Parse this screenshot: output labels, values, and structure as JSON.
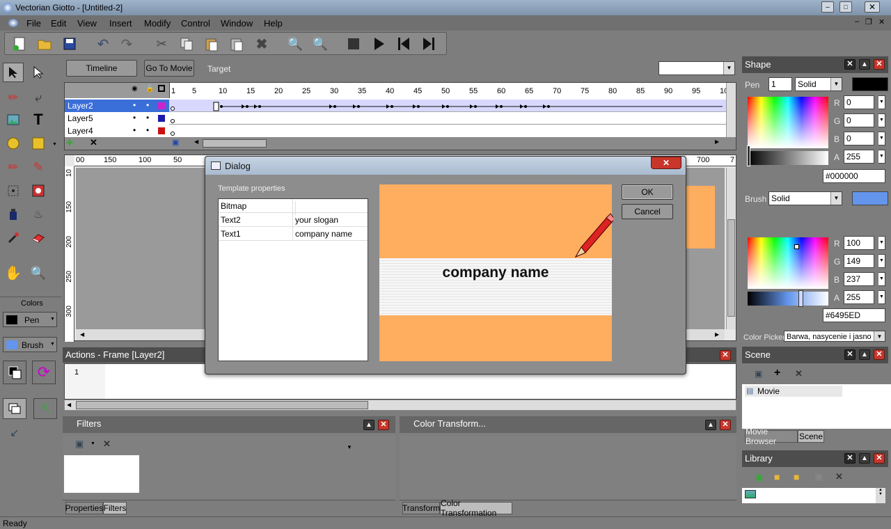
{
  "window": {
    "title": "Vectorian Giotto - [Untitled-2]",
    "status": "Ready"
  },
  "menu": [
    "File",
    "Edit",
    "View",
    "Insert",
    "Modify",
    "Control",
    "Window",
    "Help"
  ],
  "timeline_bar": {
    "timeline_button": "Timeline",
    "goto_button": "Go To Movie",
    "target_label": "Target"
  },
  "timeline": {
    "frame_numbers": [
      "1",
      "5",
      "10",
      "15",
      "20",
      "25",
      "30",
      "35",
      "40",
      "45",
      "50",
      "55",
      "60",
      "65",
      "70",
      "75",
      "80",
      "85",
      "90",
      "95",
      "10"
    ],
    "layers": [
      {
        "name": "Layer2",
        "color": "#cc22cc",
        "selected": true
      },
      {
        "name": "Layer5",
        "color": "#1a1aaa",
        "selected": false
      },
      {
        "name": "Layer4",
        "color": "#cc1111",
        "selected": false
      }
    ]
  },
  "ruler": {
    "top": [
      "00",
      "150",
      "100",
      "50",
      "700",
      "7"
    ],
    "left": [
      "10",
      "150",
      "200",
      "250",
      "300"
    ]
  },
  "tools": {
    "colors_label": "Colors",
    "pen_label": "Pen",
    "brush_label": "Brush",
    "pen_color": "#000000",
    "brush_color": "#6495ED"
  },
  "actions": {
    "title": "Actions - Frame [Layer2]",
    "line_number": "1"
  },
  "filters": {
    "title": "Filters",
    "tabs": [
      "Properties",
      "Filters"
    ]
  },
  "color_transform": {
    "title": "Color Transform...",
    "tabs": [
      "Transform",
      "Color Transformation"
    ]
  },
  "shape": {
    "title": "Shape",
    "pen_label": "Pen",
    "pen_width": "1",
    "pen_style": "Solid",
    "pen_r": "0",
    "pen_g": "0",
    "pen_b": "0",
    "pen_a": "255",
    "pen_hex": "#000000",
    "brush_label": "Brush",
    "brush_style": "Solid",
    "brush_r": "100",
    "brush_g": "149",
    "brush_b": "237",
    "brush_a": "255",
    "brush_hex": "#6495ED",
    "color_picker_label": "Color Picker",
    "color_picker_value": "Barwa, nasycenie i jasno",
    "channel_labels": [
      "R",
      "G",
      "B",
      "A"
    ]
  },
  "scene": {
    "title": "Scene",
    "item": "Movie",
    "tabs": [
      "Movie Browser",
      "Scene"
    ]
  },
  "library": {
    "title": "Library"
  },
  "dialog": {
    "title": "Dialog",
    "group_label": "Template properties",
    "ok": "OK",
    "cancel": "Cancel",
    "rows": [
      {
        "name": "Bitmap",
        "value": ""
      },
      {
        "name": "Text2",
        "value": "your slogan"
      },
      {
        "name": "Text1",
        "value": "company name"
      }
    ],
    "preview_text": "company name",
    "preview_bg": "#FFAD5E"
  }
}
